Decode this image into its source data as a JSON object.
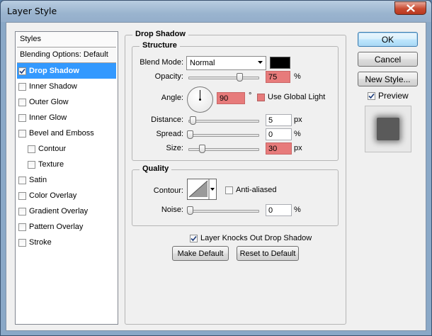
{
  "window": {
    "title": "Layer Style"
  },
  "styles": {
    "header": "Styles",
    "blending_options": "Blending Options: Default",
    "items": [
      {
        "label": "Drop Shadow",
        "checked": true,
        "selected": true
      },
      {
        "label": "Inner Shadow",
        "checked": false
      },
      {
        "label": "Outer Glow",
        "checked": false
      },
      {
        "label": "Inner Glow",
        "checked": false
      },
      {
        "label": "Bevel and Emboss",
        "checked": false
      },
      {
        "label": "Contour",
        "checked": false,
        "indent": true
      },
      {
        "label": "Texture",
        "checked": false,
        "indent": true
      },
      {
        "label": "Satin",
        "checked": false
      },
      {
        "label": "Color Overlay",
        "checked": false
      },
      {
        "label": "Gradient Overlay",
        "checked": false
      },
      {
        "label": "Pattern Overlay",
        "checked": false
      },
      {
        "label": "Stroke",
        "checked": false
      }
    ]
  },
  "drop_shadow": {
    "title": "Drop Shadow",
    "structure": {
      "title": "Structure",
      "blend_mode_label": "Blend Mode:",
      "blend_mode_value": "Normal",
      "shadow_color": "#000000",
      "opacity_label": "Opacity:",
      "opacity_value": "75",
      "opacity_unit": "%",
      "opacity_fraction": 0.75,
      "angle_label": "Angle:",
      "angle_value": "90",
      "angle_unit": "°",
      "use_global_light_label": "Use Global Light",
      "use_global_light_checked": false,
      "distance_label": "Distance:",
      "distance_value": "5",
      "distance_unit": "px",
      "spread_label": "Spread:",
      "spread_value": "0",
      "spread_unit": "%",
      "size_label": "Size:",
      "size_value": "30",
      "size_unit": "px"
    },
    "quality": {
      "title": "Quality",
      "contour_label": "Contour:",
      "anti_aliased_label": "Anti-aliased",
      "anti_aliased_checked": false,
      "noise_label": "Noise:",
      "noise_value": "0",
      "noise_unit": "%"
    },
    "knock_out_label": "Layer Knocks Out Drop Shadow",
    "knock_out_checked": true,
    "make_default_label": "Make Default",
    "reset_default_label": "Reset to Default"
  },
  "buttons": {
    "ok": "OK",
    "cancel": "Cancel",
    "new_style": "New Style...",
    "preview_label": "Preview",
    "preview_checked": true
  },
  "colors": {
    "selection": "#3399ff",
    "highlight_field": "#e77b7b"
  }
}
